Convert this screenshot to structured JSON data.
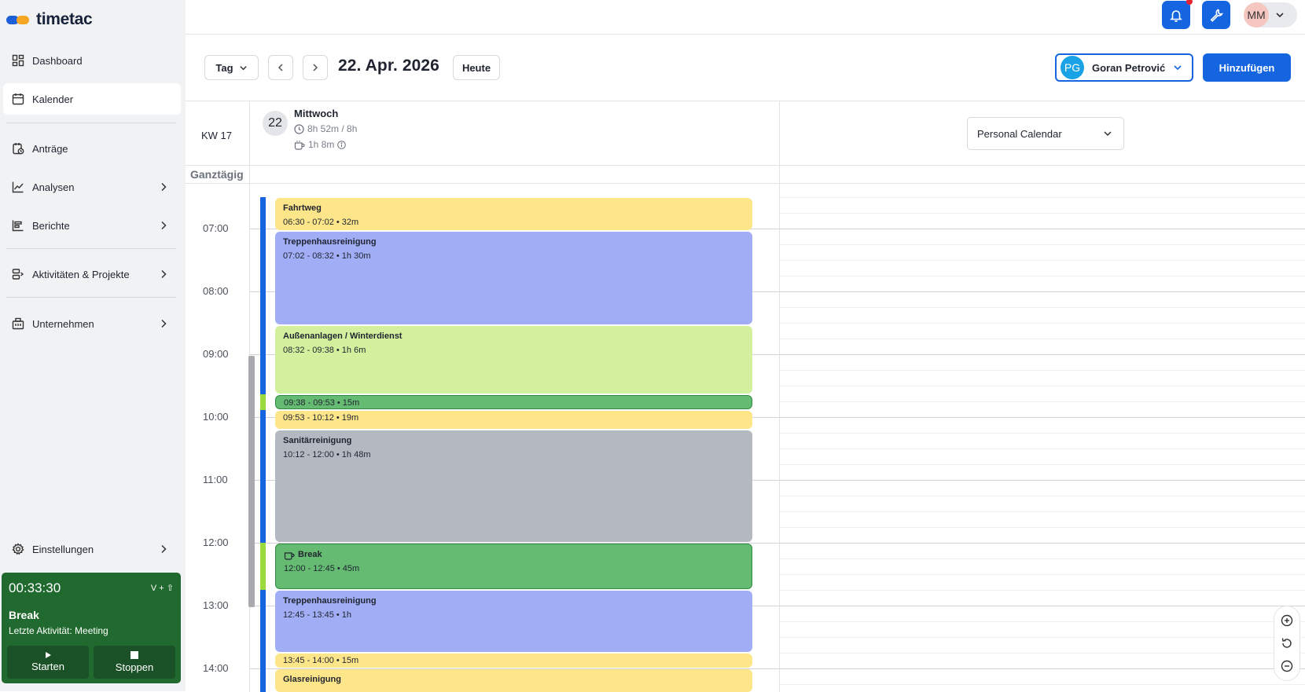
{
  "app": {
    "logo_text": "timetac"
  },
  "sidebar": {
    "items": [
      {
        "label": "Dashboard",
        "icon": "dashboard-icon"
      },
      {
        "label": "Kalender",
        "icon": "calendar-icon",
        "active": true
      },
      {
        "label": "Anträge",
        "icon": "requests-icon"
      },
      {
        "label": "Analysen",
        "icon": "analytics-icon",
        "has_submenu": true
      },
      {
        "label": "Berichte",
        "icon": "reports-icon",
        "has_submenu": true
      },
      {
        "label": "Aktivitäten & Projekte",
        "icon": "projects-icon",
        "has_submenu": true
      },
      {
        "label": "Unternehmen",
        "icon": "company-icon",
        "has_submenu": true
      },
      {
        "label": "Einstellungen",
        "icon": "settings-icon",
        "has_submenu": true
      }
    ]
  },
  "timer": {
    "time": "00:33:30",
    "shortcut": "V + ⇧",
    "status": "Break",
    "last_activity": "Letzte Aktivität: Meeting",
    "start_label": "Starten",
    "stop_label": "Stoppen"
  },
  "topbar": {
    "user_initials": "MM",
    "has_notification": true
  },
  "toolbar": {
    "view": "Tag",
    "date": "22. Apr. 2026",
    "today_label": "Heute",
    "user_initials": "PG",
    "user_name": "Goran Petrović",
    "add_label": "Hinzufügen"
  },
  "calendar": {
    "week": "KW 17",
    "day_number": "22",
    "day_name": "Mittwoch",
    "worked": "8h 52m / 8h",
    "break_total": "1h 8m",
    "calendar_select": "Personal Calendar",
    "all_day_label": "Ganztägig",
    "hours": [
      "07:00",
      "08:00",
      "09:00",
      "10:00",
      "11:00",
      "12:00",
      "13:00",
      "14:00"
    ],
    "events": [
      {
        "title": "Fahrtweg",
        "time": "06:30 - 07:02 • 32m",
        "color": "#fde68a",
        "start": "06:30",
        "end": "07:02"
      },
      {
        "title": "Treppenhausreinigung",
        "time": "07:02 - 08:32 • 1h 30m",
        "color": "#a1adf5",
        "start": "07:02",
        "end": "08:32"
      },
      {
        "title": "Außenanlagen / Winterdienst",
        "time": "08:32 - 09:38 • 1h 6m",
        "color": "#d3f09e",
        "start": "08:32",
        "end": "09:38"
      },
      {
        "title": "",
        "time": "09:38 - 09:53 • 15m",
        "color": "#66bb72",
        "start": "09:38",
        "end": "09:53",
        "border": "#2f8a40"
      },
      {
        "title": "",
        "time": "09:53 - 10:12 • 19m",
        "color": "#fde68a",
        "start": "09:53",
        "end": "10:12"
      },
      {
        "title": "Sanitärreinigung",
        "time": "10:12 - 12:00 • 1h 48m",
        "color": "#b4b9c1",
        "start": "10:12",
        "end": "12:00"
      },
      {
        "title": "Break",
        "time": "12:00 - 12:45 • 45m",
        "color": "#66bb72",
        "start": "12:00",
        "end": "12:45",
        "border": "#2f8a40",
        "icon": "cup-icon"
      },
      {
        "title": "Treppenhausreinigung",
        "time": "12:45 - 13:45 • 1h",
        "color": "#a1adf5",
        "start": "12:45",
        "end": "13:45"
      },
      {
        "title": "",
        "time": "13:45 - 14:00 • 15m",
        "color": "#fde68a",
        "start": "13:45",
        "end": "14:00"
      },
      {
        "title": "Glasreinigung",
        "time": "",
        "color": "#fde68a",
        "start": "14:00",
        "end": "15:00"
      }
    ],
    "track_segments": [
      {
        "start": "06:30",
        "end": "09:38",
        "color": "#1565e0"
      },
      {
        "start": "09:38",
        "end": "09:53",
        "color": "#9bd93c"
      },
      {
        "start": "09:53",
        "end": "12:00",
        "color": "#1565e0"
      },
      {
        "start": "12:00",
        "end": "12:45",
        "color": "#9bd93c"
      },
      {
        "start": "12:45",
        "end": "15:00",
        "color": "#1565e0"
      }
    ]
  }
}
